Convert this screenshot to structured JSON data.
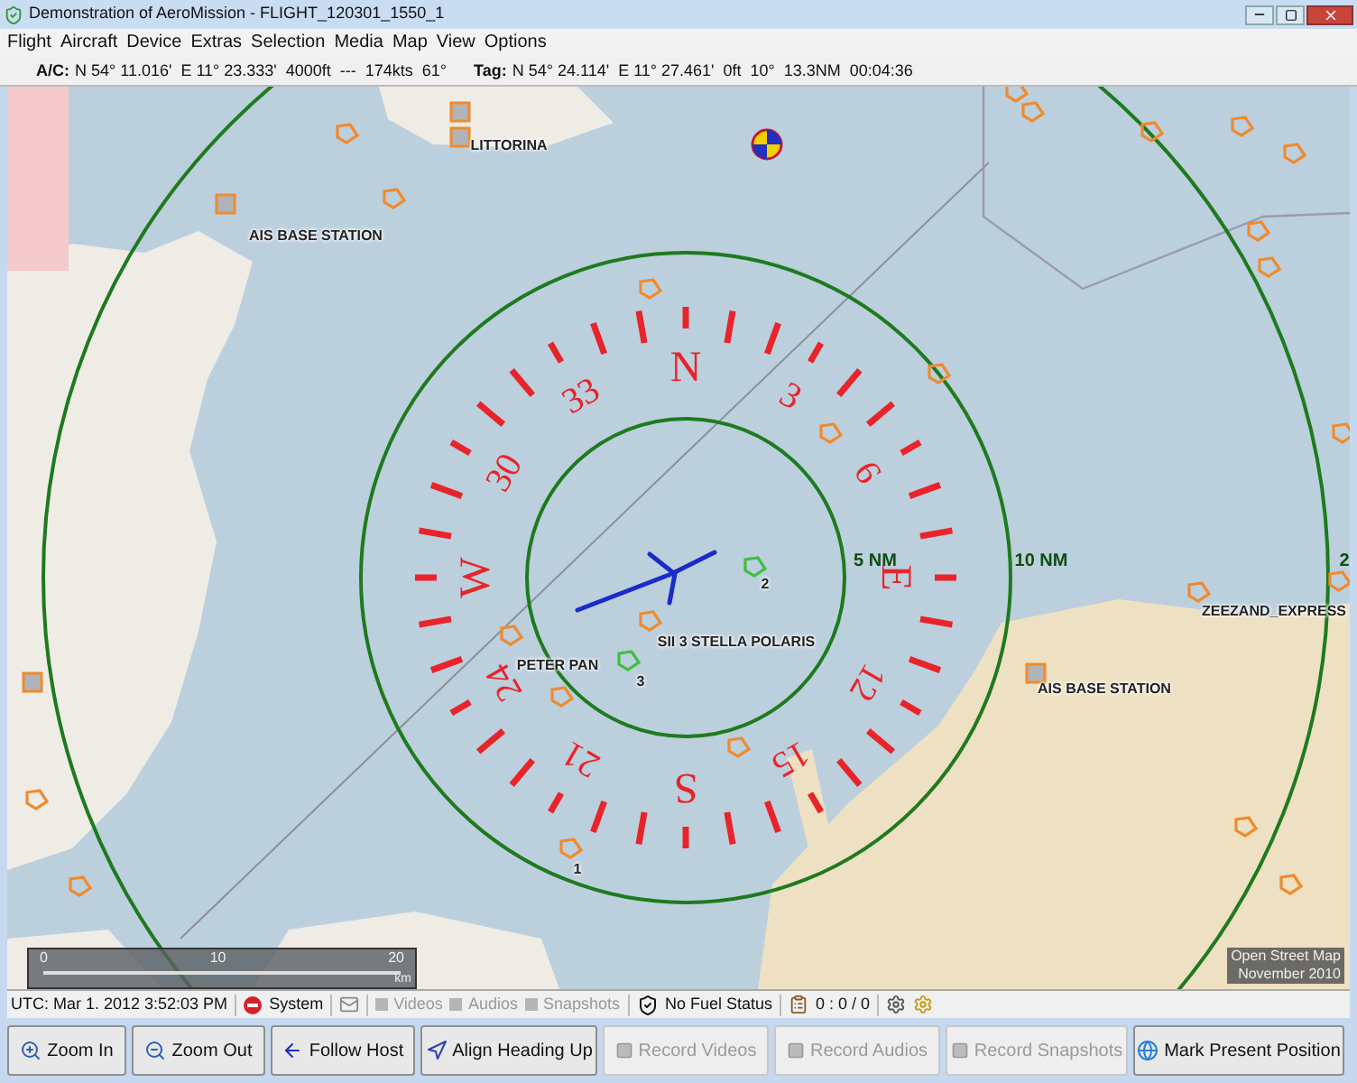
{
  "window": {
    "title": "Demonstration of AeroMission - FLIGHT_120301_1550_1"
  },
  "menu": [
    "Flight",
    "Aircraft",
    "Device",
    "Extras",
    "Selection",
    "Media",
    "Map",
    "View",
    "Options"
  ],
  "info_bar": {
    "ac_label": "A/C:",
    "ac_values": "N 54° 11.016'  E 11° 23.333'  4000ft  ---  174kts  61°",
    "tag_label": "Tag:",
    "tag_values": "N 54° 24.114'  E 11° 27.461'  0ft  10°  13.3NM  00:04:36"
  },
  "map": {
    "compass_labels": [
      "N",
      "3",
      "6",
      "E",
      "12",
      "15",
      "S",
      "21",
      "24",
      "W",
      "30",
      "33"
    ],
    "range_labels": [
      "5 NM",
      "10 NM",
      "2"
    ],
    "vessel_labels": [
      "LITTORINA",
      "AIS BASE STATION",
      "PETER PAN",
      "SII 3 STELLA POLARIS",
      "ZEEZAND_EXPRESS",
      "AIS BASE STATION"
    ],
    "target_numbers": [
      "2",
      "3",
      "1"
    ],
    "scale_ticks": [
      "0",
      "10",
      "20"
    ],
    "scale_unit": "km",
    "attribution": [
      "Open Street Map",
      "November 2010"
    ]
  },
  "status_bar": {
    "utc": "UTC: Mar 1. 2012 3:52:03 PM",
    "system": "System",
    "recordings": [
      {
        "label": "Videos",
        "enabled": false
      },
      {
        "label": "Audios",
        "enabled": false
      },
      {
        "label": "Snapshots",
        "enabled": false
      }
    ],
    "fuel": "No Fuel Status",
    "counter": "0 : 0 / 0"
  },
  "buttons": [
    {
      "label": "Zoom In",
      "disabled": false
    },
    {
      "label": "Zoom Out",
      "disabled": false
    },
    {
      "label": "Follow Host",
      "disabled": false
    },
    {
      "label": "Align Heading Up",
      "disabled": false
    },
    {
      "label": "Record Videos",
      "disabled": true
    },
    {
      "label": "Record Audios",
      "disabled": true
    },
    {
      "label": "Record Snapshots",
      "disabled": true
    },
    {
      "label": "Mark Present Position",
      "disabled": false
    }
  ]
}
